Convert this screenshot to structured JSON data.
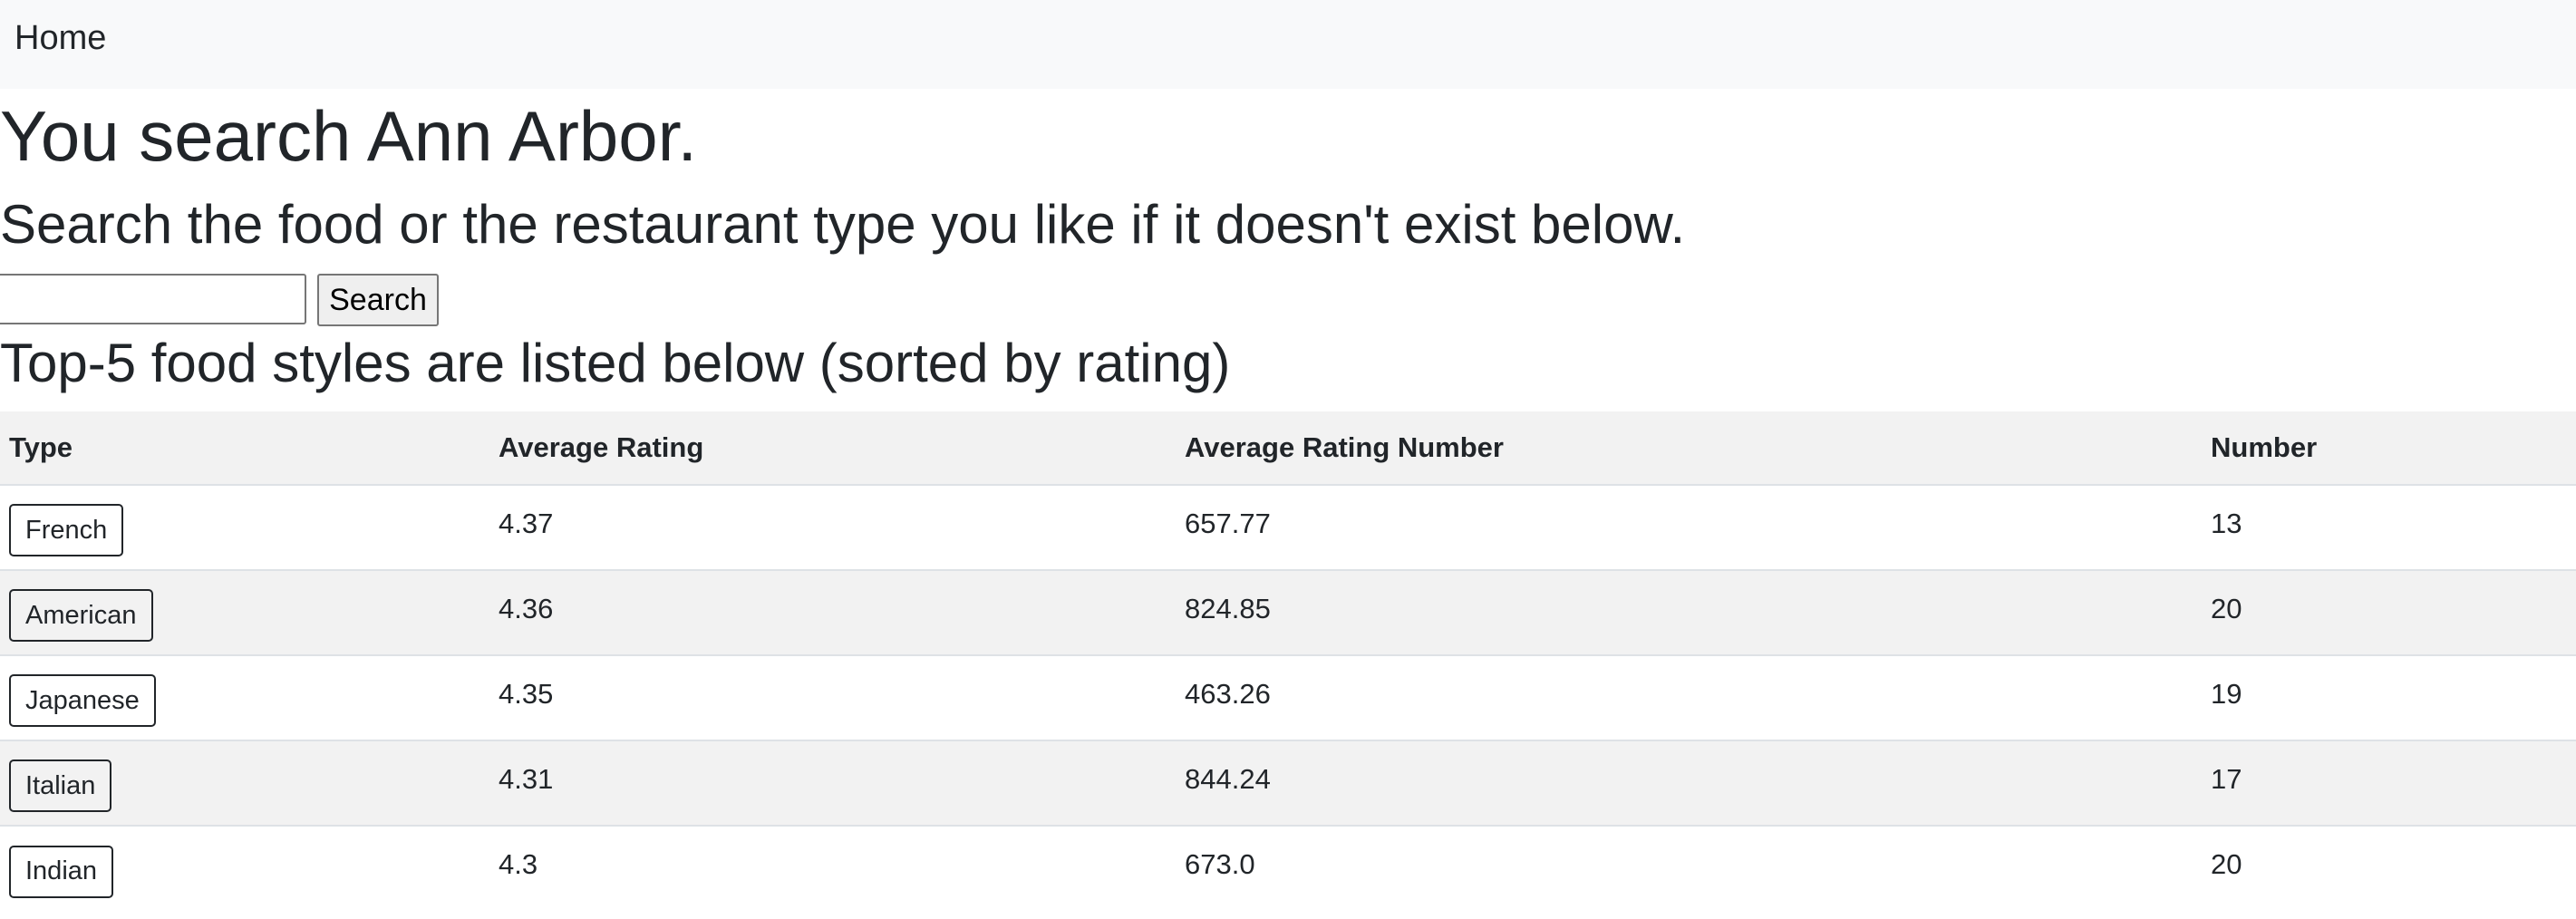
{
  "nav": {
    "home_label": "Home"
  },
  "page": {
    "title": "You search Ann Arbor.",
    "subtitle": "Search the food or the restaurant type you like if it doesn't exist below.",
    "section_title": "Top-5 food styles are listed below (sorted by rating)"
  },
  "search": {
    "value": "",
    "placeholder": "",
    "button_label": "Search"
  },
  "table": {
    "headers": [
      "Type",
      "Average Rating",
      "Average Rating Number",
      "Number"
    ],
    "rows": [
      {
        "type": "French",
        "avg_rating": "4.37",
        "avg_rating_number": "657.77",
        "number": "13"
      },
      {
        "type": "American",
        "avg_rating": "4.36",
        "avg_rating_number": "824.85",
        "number": "20"
      },
      {
        "type": "Japanese",
        "avg_rating": "4.35",
        "avg_rating_number": "463.26",
        "number": "19"
      },
      {
        "type": "Italian",
        "avg_rating": "4.31",
        "avg_rating_number": "844.24",
        "number": "17"
      },
      {
        "type": "Indian",
        "avg_rating": "4.3",
        "avg_rating_number": "673.0",
        "number": "20"
      }
    ]
  },
  "colors": {
    "text": "#212529",
    "navbar_bg": "#f8f9fa",
    "stripe_bg": "#f2f2f2",
    "border": "#dee2e6"
  }
}
